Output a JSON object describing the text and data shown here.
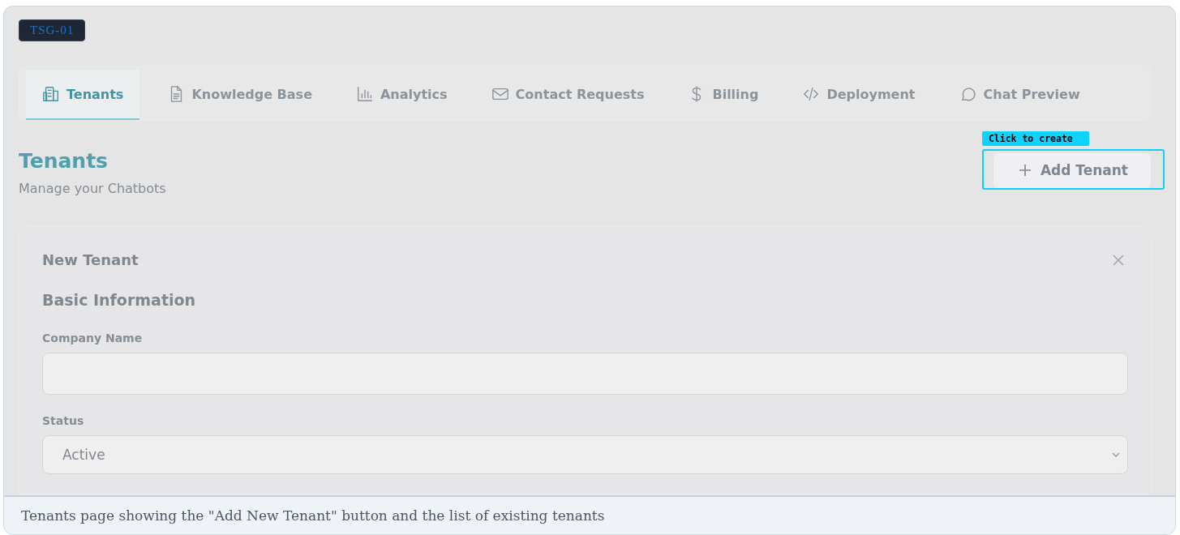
{
  "badge": "TSG-01",
  "tabs": [
    {
      "label": "Tenants",
      "selected": true
    },
    {
      "label": "Knowledge Base",
      "selected": false
    },
    {
      "label": "Analytics",
      "selected": false
    },
    {
      "label": "Contact Requests",
      "selected": false
    },
    {
      "label": "Billing",
      "selected": false
    },
    {
      "label": "Deployment",
      "selected": false
    },
    {
      "label": "Chat Preview",
      "selected": false
    }
  ],
  "header": {
    "title": "Tenants",
    "subtitle": "Manage your Chatbots"
  },
  "add_button": {
    "label": "Add Tenant",
    "callout": "Click to create"
  },
  "form": {
    "title": "New Tenant",
    "section": "Basic Information",
    "fields": [
      {
        "kind": "text",
        "label": "Company Name"
      },
      {
        "kind": "select",
        "label": "Status",
        "value": "Active"
      }
    ]
  },
  "caption": "Tenants page showing the \"Add New Tenant\" button and the list of existing tenants"
}
